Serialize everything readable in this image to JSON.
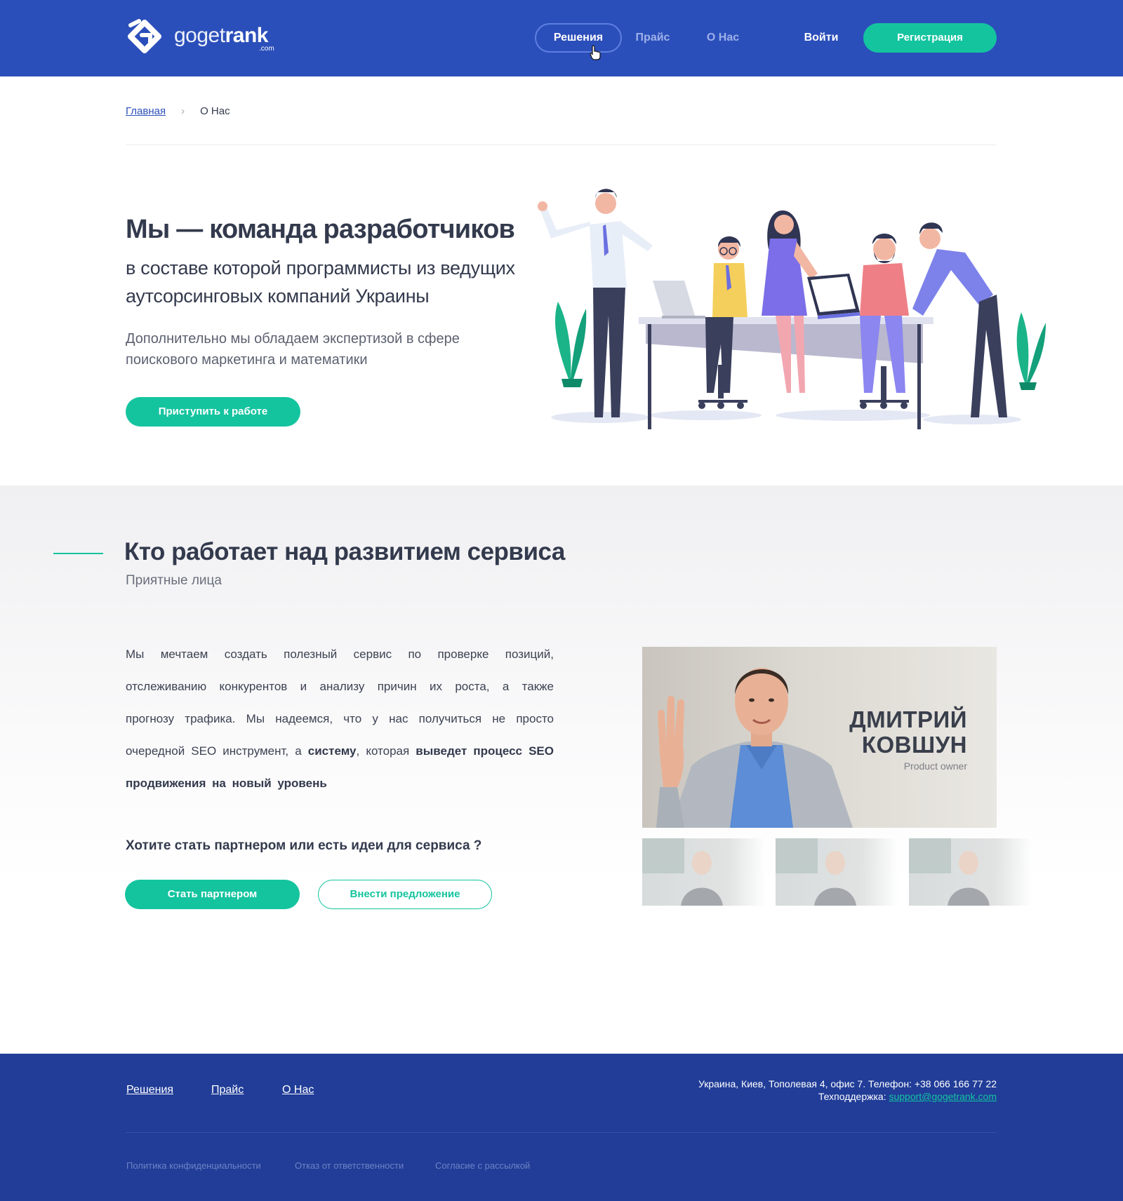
{
  "brand": {
    "name_light": "goget",
    "name_bold": "rank",
    "domain_suffix": ".com",
    "primary_color": "#2b4fba",
    "accent_color": "#14c49f",
    "footer_color": "#213d98"
  },
  "header": {
    "nav": [
      "Решения",
      "Прайс",
      "О Нас"
    ],
    "active_nav": "Решения",
    "login_label": "Войти",
    "register_label": "Регистрация"
  },
  "breadcrumb": {
    "home": "Главная",
    "separator": "›",
    "current": "О Нас"
  },
  "hero": {
    "title": "Мы — команда разработчиков",
    "subtitle": "в составе которой программисты из ведущих аутсорсинговых компаний Украины",
    "text": "Дополнительно мы обладаем экспертизой в сфере поискового маркетинга и математики",
    "cta_label": "Приступить к работе"
  },
  "team": {
    "title": "Кто работает над развитием сервиса",
    "subtitle": "Приятные лица",
    "text_parts": [
      "Мы мечтаем создать полезный сервис по проверке позиций, отслеживанию конкурентов и анализу причин их роста, а также прогнозу трафика. Мы надеемся, что у нас получиться не просто очередной SEO инструмент, а ",
      "систему",
      ", которая ",
      "выведет процесс SEO продвижения на новый уровень"
    ],
    "partner_question": "Хотите стать партнером или есть идеи для сервиса ?",
    "partner_button": "Стать партнером",
    "suggest_button": "Внести предложение",
    "featured_member": {
      "name_line1": "ДМИТРИЙ",
      "name_line2": "КОВШУН",
      "role": "Product owner"
    }
  },
  "footer": {
    "links": [
      "Решения",
      "Прайс",
      "О Нас"
    ],
    "address": "Украина, Киев, Тополевая 4, офис 7. Телефон: +38 066 166 77 22",
    "support_label": "Техподдержка: ",
    "support_email": "support@gogetrank.com",
    "legal": [
      "Политика конфиденциальности",
      "Отказ от ответственности",
      "Согласие с рассылкой"
    ]
  }
}
